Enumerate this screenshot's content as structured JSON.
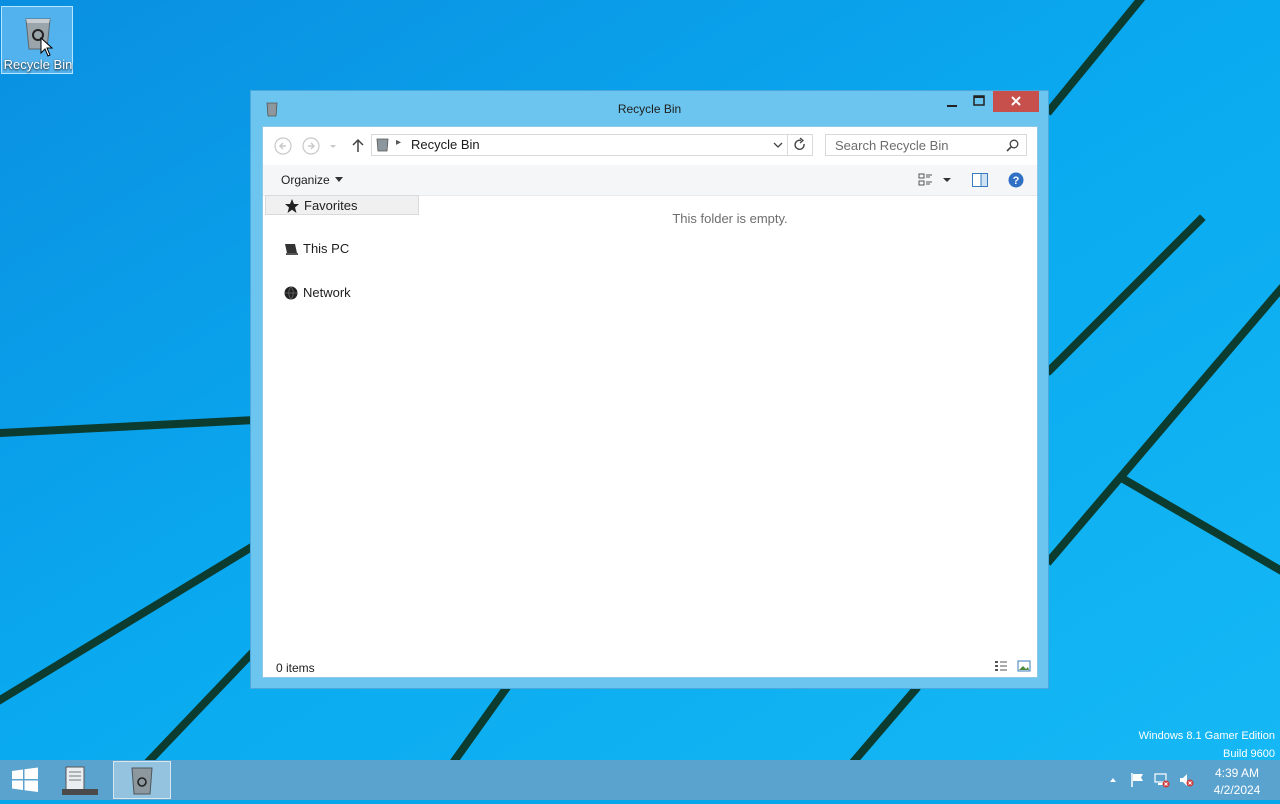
{
  "desktop": {
    "icons": [
      {
        "label": "Recycle Bin",
        "icon": "recycle-bin-icon"
      }
    ],
    "watermark": {
      "line1": "Windows 8.1 Gamer Edition",
      "line2": "Build 9600"
    }
  },
  "window": {
    "title": "Recycle Bin",
    "controls": {
      "minimize": "minimize-icon",
      "maximize": "maximize-icon",
      "close": "close-icon"
    },
    "address": {
      "path": "Recycle Bin"
    },
    "search": {
      "placeholder": "Search Recycle Bin"
    },
    "toolbar": {
      "organize_label": "Organize"
    },
    "nav_pane": [
      {
        "label": "Favorites",
        "icon": "star-icon",
        "selected": true
      },
      {
        "label": "This PC",
        "icon": "computer-icon"
      },
      {
        "label": "Network",
        "icon": "network-icon"
      }
    ],
    "content": {
      "empty_message": "This folder is empty."
    },
    "status": {
      "count": "0 items"
    }
  },
  "taskbar": {
    "apps": [
      {
        "name": "file-explorer",
        "active": false
      },
      {
        "name": "recycle-bin",
        "active": true
      }
    ],
    "tray": [
      "show-hidden-icons",
      "flag-icon",
      "network-error-icon",
      "volume-muted-icon"
    ],
    "clock": {
      "time": "4:39 AM",
      "date": "4/2/2024"
    }
  },
  "colors": {
    "desktop": "#07a6e8",
    "frame": "#6cc5ef",
    "close": "#c7504c",
    "taskbar": "#5ba3cf"
  }
}
